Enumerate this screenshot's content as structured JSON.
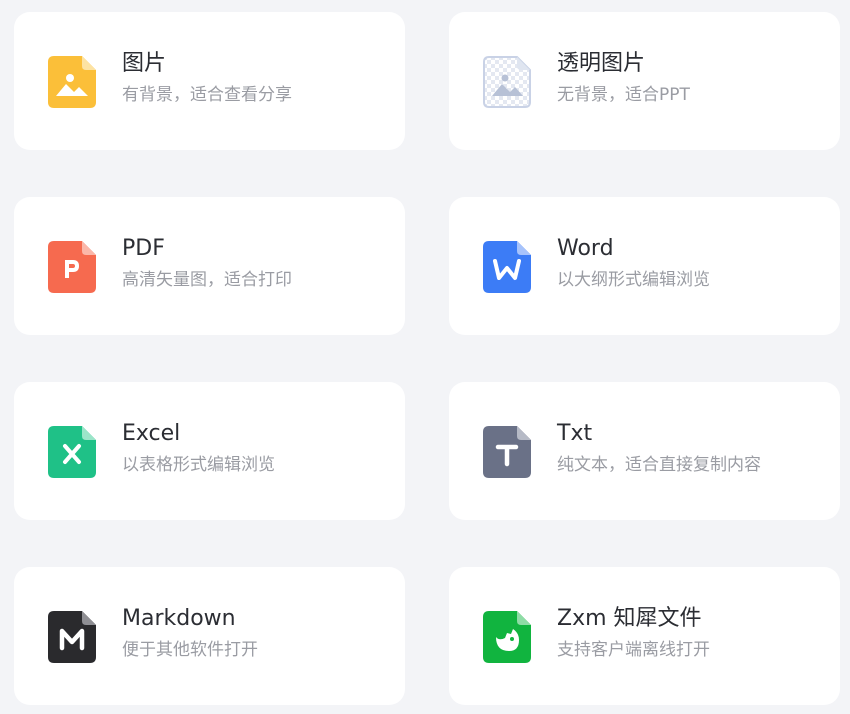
{
  "cards": [
    {
      "title": "图片",
      "subtitle": "有背景，适合查看分享",
      "icon": "image-file-icon",
      "color": "#fbbf39"
    },
    {
      "title": "透明图片",
      "subtitle": "无背景，适合PPT",
      "icon": "transparent-image-file-icon",
      "color": "#c9d2e6"
    },
    {
      "title": "PDF",
      "subtitle": "高清矢量图，适合打印",
      "icon": "pdf-file-icon",
      "color": "#f66a4f"
    },
    {
      "title": "Word",
      "subtitle": "以大纲形式编辑浏览",
      "icon": "word-file-icon",
      "color": "#3c7cf6"
    },
    {
      "title": "Excel",
      "subtitle": "以表格形式编辑浏览",
      "icon": "excel-file-icon",
      "color": "#1fc187"
    },
    {
      "title": "Txt",
      "subtitle": "纯文本，适合直接复制内容",
      "icon": "txt-file-icon",
      "color": "#6a7187"
    },
    {
      "title": "Markdown",
      "subtitle": "便于其他软件打开",
      "icon": "markdown-file-icon",
      "color": "#2a2a2d"
    },
    {
      "title": "Zxm 知犀文件",
      "subtitle": "支持客户端离线打开",
      "icon": "zxm-file-icon",
      "color": "#11b43f"
    }
  ]
}
